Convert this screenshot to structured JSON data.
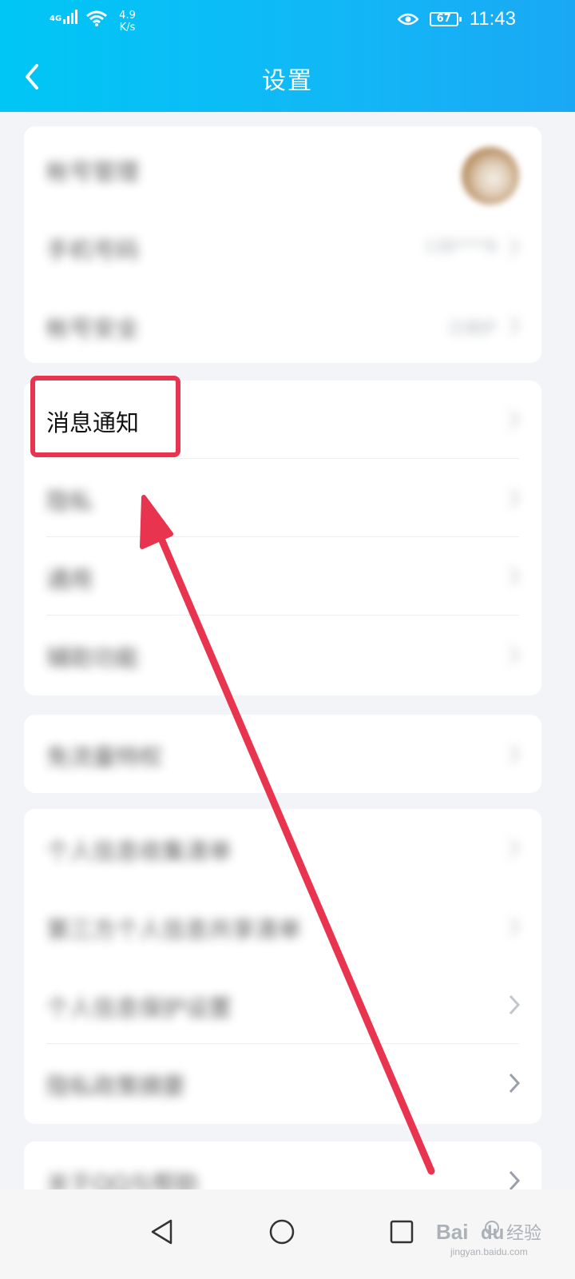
{
  "status_bar": {
    "network": "4G",
    "speed_value": "4.9",
    "speed_unit": "K/s",
    "battery": "67",
    "time": "11:43"
  },
  "header": {
    "title": "设置"
  },
  "groups": [
    {
      "rows": [
        {
          "label": "帐号管理",
          "value": ""
        },
        {
          "label": "手机号码",
          "value": "138****8"
        },
        {
          "label": "帐号安全",
          "value": "已保护"
        }
      ]
    },
    {
      "rows": [
        {
          "label": "消息通知"
        },
        {
          "label": "隐私"
        },
        {
          "label": "通用"
        },
        {
          "label": "辅助功能"
        }
      ]
    },
    {
      "rows": [
        {
          "label": "免流量特权"
        }
      ]
    },
    {
      "rows": [
        {
          "label": "个人信息收集清单"
        },
        {
          "label": "第三方个人信息共享清单"
        },
        {
          "label": "个人信息保护设置"
        },
        {
          "label": "隐私政策摘要"
        }
      ]
    },
    {
      "rows": [
        {
          "label": "关于QQ与帮助"
        }
      ]
    }
  ],
  "watermark": {
    "text": "Baidu经验",
    "sub": "jingyan.baidu.com"
  },
  "colors": {
    "header": "#12b7f6",
    "annotation": "#e8344e"
  }
}
